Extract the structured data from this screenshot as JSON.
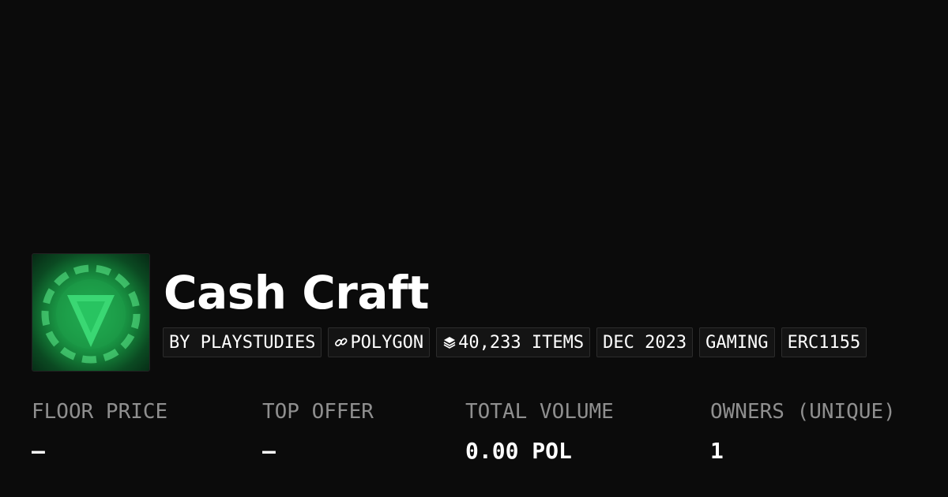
{
  "collection": {
    "name": "Cash Craft",
    "avatar_icon": "green-chip-logo"
  },
  "chips": {
    "creator": "BY PLAYSTUDIES",
    "chain": "POLYGON",
    "chain_icon": "link-icon",
    "items": "40,233 ITEMS",
    "items_icon": "layers-icon",
    "created": "DEC 2023",
    "category": "GAMING",
    "standard": "ERC1155"
  },
  "stats": {
    "floor_price": {
      "label": "FLOOR PRICE",
      "value": "–"
    },
    "top_offer": {
      "label": "TOP OFFER",
      "value": "–"
    },
    "total_volume": {
      "label": "TOTAL VOLUME",
      "value": "0.00 POL"
    },
    "owners": {
      "label": "OWNERS (UNIQUE)",
      "value": "1"
    }
  },
  "colors": {
    "background": "#0b0b0b",
    "label": "#8f8f8f",
    "text": "#ffffff",
    "chip_bg": "#141414",
    "accent_green": "#1ea94e"
  }
}
